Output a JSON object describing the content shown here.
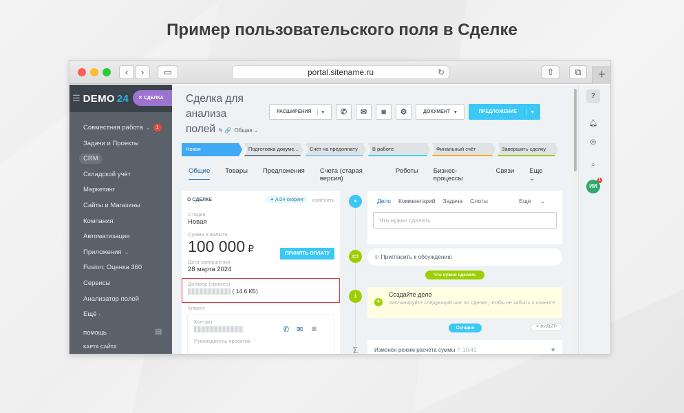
{
  "heading": "Пример  пользовательского поля в Сделке",
  "browser": {
    "url": "portal.sitename.ru",
    "reload_icon": "reload-icon",
    "plus": "+"
  },
  "sidebar": {
    "logo_text": "DEMO",
    "logo_num": "24",
    "deal_pill": "✕ СДЕЛКА",
    "items": [
      {
        "label": "Совместная работа",
        "badge": "1"
      },
      {
        "label": "Задачи и Проекты"
      },
      {
        "label": "CRM"
      },
      {
        "label": "Складской учёт"
      },
      {
        "label": "Маркетинг"
      },
      {
        "label": "Сайты и Магазины"
      },
      {
        "label": "Компания"
      },
      {
        "label": "Автоматизация"
      },
      {
        "label": "Приложения"
      },
      {
        "label": "Fusion: Оценка 360"
      },
      {
        "label": "Сервисы"
      },
      {
        "label": "Анализатор полей"
      },
      {
        "label": "Ещё ·"
      }
    ],
    "help": "ПОМОЩЬ",
    "sitemap": "КАРТА САЙТА"
  },
  "deal": {
    "title_line1": "Сделка для",
    "title_line2": "анализа",
    "title_line3": "полей",
    "category": "Общая"
  },
  "toolbar": {
    "extensions": "РАСШИРЕНИЯ",
    "document": "ДОКУМЕНТ",
    "proposal": "ПРЕДЛОЖЕНИЕ"
  },
  "stages": [
    {
      "label": "Новая",
      "color": "#3fa9f5"
    },
    {
      "label": "Подготовка докуме...",
      "color": "#6f7b86"
    },
    {
      "label": "Счёт на предоплату",
      "color": "#8ac8ec"
    },
    {
      "label": "В работе",
      "color": "#47d1e2"
    },
    {
      "label": "Финальный счёт",
      "color": "#ffa900"
    },
    {
      "label": "Завершить сделку",
      "color": "#9dcf00"
    }
  ],
  "tabs": [
    "Общие",
    "Товары",
    "Предложения",
    "Счета (старая версия)",
    "Роботы",
    "Бизнес-процессы",
    "Связи",
    "Еще"
  ],
  "about": {
    "header": "О СДЕЛКЕ",
    "ai_pill": "AI24-скоринг",
    "edit": "изменить",
    "stage_label": "Стадия",
    "stage_value": "Новая",
    "amount_label": "Сумма и валюта",
    "amount_value": "100 000",
    "currency": "₽",
    "pay_button": "ПРИНЯТЬ ОПЛАТУ",
    "date_label": "Дата завершения",
    "date_value": "28 марта 2024",
    "contract_label": "Договор (пример)",
    "contract_size": "( 14.6 КБ)",
    "client_label": "Клиент",
    "contact_label": "Контакт",
    "contact_role": "Руководитель проектов"
  },
  "activity": {
    "tabs": [
      "Дело",
      "Комментарий",
      "Задача",
      "Слоты"
    ],
    "more": "Еще",
    "placeholder": "Что нужно сделать",
    "invite": "Пригласить к обсуждению",
    "todo_label": "Что нужно сделать",
    "todo_title": "Создайте дело",
    "todo_hint": "Запланируйте следующий шаг по сделке, чтобы не забыть о клиенте",
    "today": "Сегодня",
    "filter": "ФИЛЬТР",
    "history_text": "Изменён режим расчёта суммы",
    "history_time": "10:41"
  },
  "rightbar": {
    "avatar": "ИИ",
    "avatar_badge": "1"
  }
}
